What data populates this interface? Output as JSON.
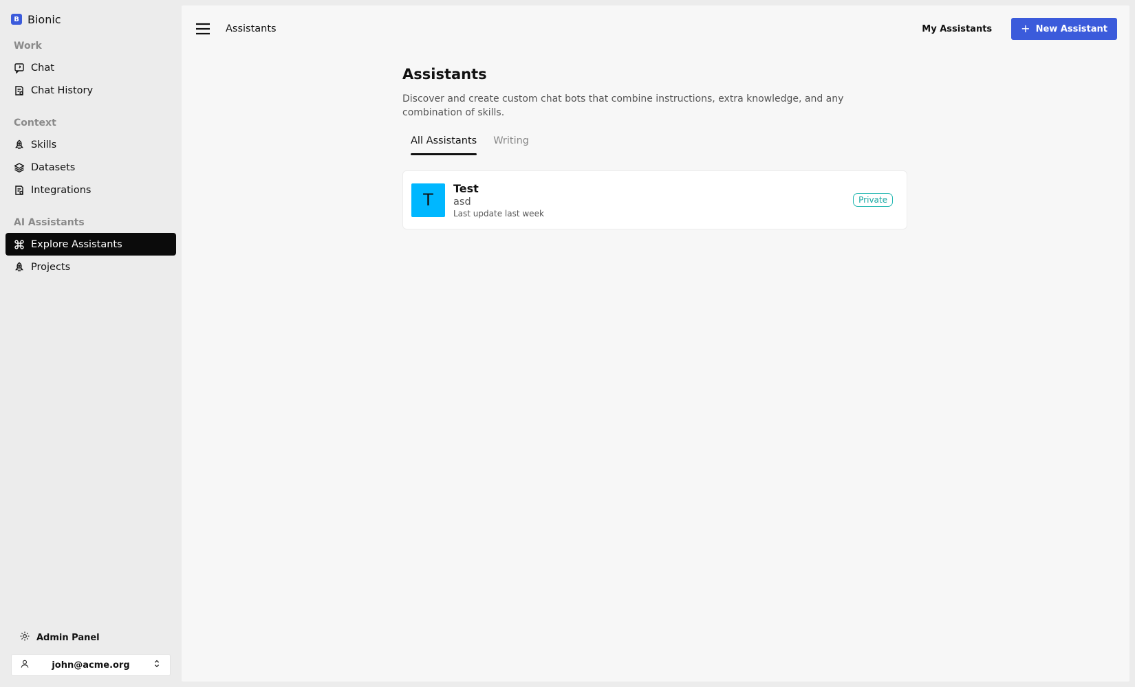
{
  "brand": {
    "initial": "B",
    "name": "Bionic"
  },
  "sidebar": {
    "sections": [
      {
        "title": "Work",
        "items": [
          {
            "label": "Chat",
            "icon": "chat-icon"
          },
          {
            "label": "Chat History",
            "icon": "history-icon"
          }
        ]
      },
      {
        "title": "Context",
        "items": [
          {
            "label": "Skills",
            "icon": "rocket-icon"
          },
          {
            "label": "Datasets",
            "icon": "layers-icon"
          },
          {
            "label": "Integrations",
            "icon": "integrations-icon"
          }
        ]
      },
      {
        "title": "AI Assistants",
        "items": [
          {
            "label": "Explore Assistants",
            "icon": "command-icon",
            "active": true
          },
          {
            "label": "Projects",
            "icon": "rocket-icon"
          }
        ]
      }
    ],
    "admin_label": "Admin Panel",
    "user_email": "john@acme.org"
  },
  "topbar": {
    "crumb": "Assistants",
    "my_assistants": "My Assistants",
    "new_assistant": "New Assistant"
  },
  "page": {
    "title": "Assistants",
    "description": "Discover and create custom chat bots that combine instructions, extra knowledge, and any combination of skills.",
    "tabs": [
      {
        "label": "All Assistants",
        "active": true
      },
      {
        "label": "Writing",
        "active": false
      }
    ],
    "cards": [
      {
        "initial": "T",
        "title": "Test",
        "subtitle": "asd",
        "meta": "Last update last week",
        "badge": "Private"
      }
    ]
  },
  "colors": {
    "accent": "#3b5bdb",
    "avatar": "#00b7ff",
    "private_badge": "#1fb6b0",
    "active_nav": "#0b0b0b"
  }
}
